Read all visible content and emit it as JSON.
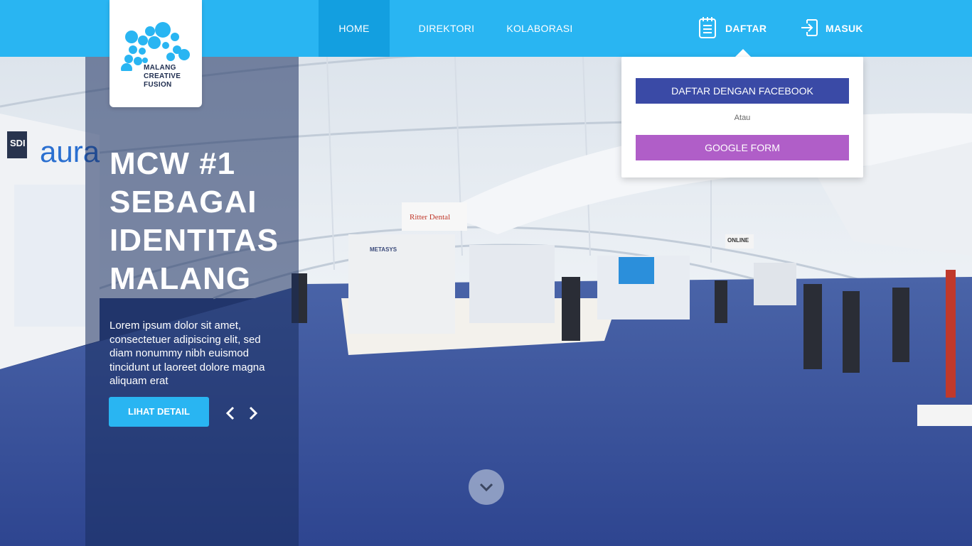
{
  "brand": {
    "logo_line1": "MALANG",
    "logo_line2": "CREATIVE",
    "logo_line3": "FUSION",
    "logo_icon": "bubbles-logo-icon",
    "primary_color": "#29b5f2",
    "active_nav_color": "#139fe0"
  },
  "nav": {
    "home": "HOME",
    "direktori": "DIREKTORI",
    "kolaborasi": "KOLABORASI",
    "daftar": "DAFTAR",
    "daftar_icon": "clipboard-list-icon",
    "masuk": "MASUK",
    "masuk_icon": "sign-in-icon"
  },
  "dropdown": {
    "facebook_label": "DAFTAR DENGAN FACEBOOK",
    "facebook_color": "#3a4aa6",
    "or_label": "Atau",
    "google_form_label": "GOOGLE FORM",
    "google_form_color": "#b05ec8"
  },
  "hero": {
    "title_line1": "MCW #1",
    "title_line2": "SEBAGAI",
    "title_line3": "IDENTITAS",
    "title_line4": "MALANG",
    "description": "Lorem ipsum dolor sit amet, consectetuer adipiscing elit, sed diam nonummy nibh euismod tincidunt ut laoreet dolore magna aliquam erat",
    "detail_button": "LIHAT DETAIL",
    "prev_icon": "chevron-left-icon",
    "next_icon": "chevron-right-icon",
    "scroll_icon": "chevron-down-icon"
  },
  "background": {
    "image_description": "exhibition-hall-photo",
    "sign_left_1": "SDI",
    "sign_left_2": "aura",
    "sign_ritter": "Ritter Dental",
    "sign_metasys": "METASYS",
    "sign_online": "ONLINE"
  }
}
